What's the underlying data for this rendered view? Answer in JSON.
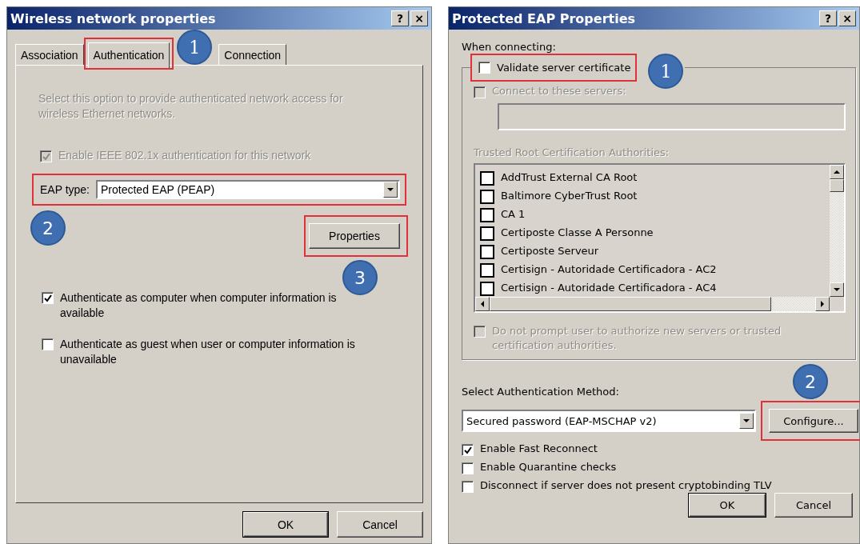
{
  "wireless_dialog": {
    "title": "Wireless network properties",
    "title_buttons": [
      "?",
      "×"
    ],
    "tabs": [
      {
        "label": "Association",
        "selected": false,
        "highlighted": false
      },
      {
        "label": "Authentication",
        "selected": true,
        "highlighted": true,
        "callout": "1"
      },
      {
        "label": "Connection",
        "selected": false,
        "highlighted": false
      }
    ],
    "description": {
      "text": "Select this option to provide authenticated network access for wireless Ethernet networks.",
      "disabled": true
    },
    "enable_8021x": {
      "label": "Enable IEEE 802.1x authentication for this network",
      "checked": true,
      "disabled": true
    },
    "eap_type": {
      "label": "EAP type:",
      "value": "Protected EAP (PEAP)",
      "highlighted": true,
      "callout": "2"
    },
    "properties_button": {
      "label": "Properties",
      "highlighted": true,
      "callout": "3"
    },
    "options": [
      {
        "label": "Authenticate as computer when computer information is available",
        "checked": true
      },
      {
        "label": "Authenticate as guest when user or computer information is unavailable",
        "checked": false
      }
    ],
    "buttons": [
      {
        "label": "OK",
        "default": true
      },
      {
        "label": "Cancel",
        "default": false
      }
    ]
  },
  "peap_dialog": {
    "title": "Protected EAP Properties",
    "title_buttons": [
      "?",
      "×"
    ],
    "when_connecting": "When connecting:",
    "validate_certificate": {
      "label": "Validate server certificate",
      "checked": false,
      "highlighted": true,
      "callout": "1"
    },
    "connect_to_servers": {
      "label": "Connect to these servers:",
      "checked": false,
      "disabled": true
    },
    "trusted_root_label": {
      "text": "Trusted Root Certification Authorities:",
      "disabled": true
    },
    "certificates": [
      {
        "label": "AddTrust External CA Root",
        "checked": false
      },
      {
        "label": "Baltimore CyberTrust Root",
        "checked": false
      },
      {
        "label": "CA 1",
        "checked": false
      },
      {
        "label": "Certiposte Classe A Personne",
        "checked": false
      },
      {
        "label": "Certiposte Serveur",
        "checked": false
      },
      {
        "label": "Certisign - Autoridade Certificadora - AC2",
        "checked": false
      },
      {
        "label": "Certisign - Autoridade Certificadora - AC4",
        "checked": false
      }
    ],
    "no_prompt": {
      "label": "Do not prompt user to authorize new servers or trusted certification authorities.",
      "checked": false,
      "disabled": true
    },
    "auth_method_label": "Select Authentication Method:",
    "auth_method": {
      "value": "Secured password (EAP-MSCHAP v2)"
    },
    "configure_button": {
      "label": "Configure...",
      "highlighted": true,
      "callout": "2"
    },
    "options": [
      {
        "label": "Enable Fast Reconnect",
        "checked": true
      },
      {
        "label": "Enable Quarantine checks",
        "checked": false
      },
      {
        "label": "Disconnect if server does not present cryptobinding TLV",
        "checked": false
      }
    ],
    "buttons": [
      {
        "label": "OK",
        "default": true
      },
      {
        "label": "Cancel",
        "default": false
      }
    ]
  }
}
